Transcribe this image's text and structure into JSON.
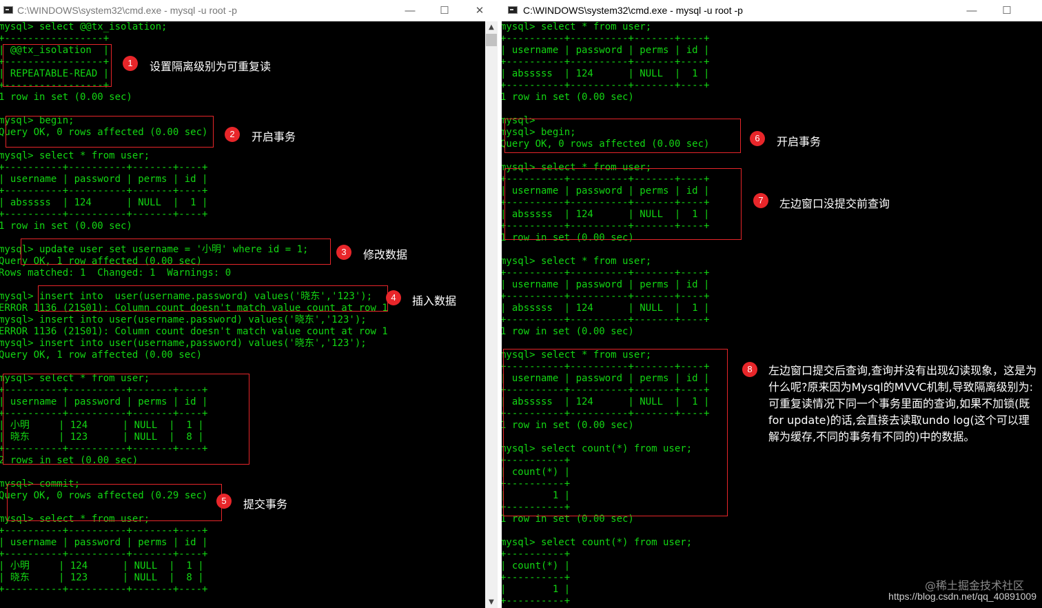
{
  "left_window": {
    "title": "C:\\WINDOWS\\system32\\cmd.exe - mysql  -u root -p",
    "lines": [
      "mysql> select @@tx_isolation;",
      "+-----------------+",
      "| @@tx_isolation  |",
      "+-----------------+",
      "| REPEATABLE-READ |",
      "+-----------------+",
      "1 row in set (0.00 sec)",
      "",
      "mysql> begin;",
      "Query OK, 0 rows affected (0.00 sec)",
      "",
      "mysql> select * from user;",
      "+----------+----------+-------+----+",
      "| username | password | perms | id |",
      "+----------+----------+-------+----+",
      "| absssss  | 124      | NULL  |  1 |",
      "+----------+----------+-------+----+",
      "1 row in set (0.00 sec)",
      "",
      "mysql> update user set username = '小明' where id = 1;",
      "Query OK, 1 row affected (0.00 sec)",
      "Rows matched: 1  Changed: 1  Warnings: 0",
      "",
      "mysql> insert into  user(username.password) values('晓东','123');",
      "ERROR 1136 (21S01): Column count doesn't match value count at row 1",
      "mysql> insert into user(username.password) values('晓东','123');",
      "ERROR 1136 (21S01): Column count doesn't match value count at row 1",
      "mysql> insert into user(username,password) values('晓东','123');",
      "Query OK, 1 row affected (0.00 sec)",
      "",
      "mysql> select * from user;",
      "+----------+----------+-------+----+",
      "| username | password | perms | id |",
      "+----------+----------+-------+----+",
      "| 小明     | 124      | NULL  |  1 |",
      "| 晓东     | 123      | NULL  |  8 |",
      "+----------+----------+-------+----+",
      "2 rows in set (0.00 sec)",
      "",
      "mysql> commit;",
      "Query OK, 0 rows affected (0.29 sec)",
      "",
      "mysql> select * from user;",
      "+----------+----------+-------+----+",
      "| username | password | perms | id |",
      "+----------+----------+-------+----+",
      "| 小明     | 124      | NULL  |  1 |",
      "| 晓东     | 123      | NULL  |  8 |",
      "+----------+----------+-------+----+"
    ]
  },
  "right_window": {
    "title": "C:\\WINDOWS\\system32\\cmd.exe - mysql  -u root -p",
    "lines": [
      "mysql> select * from user;",
      "+----------+----------+-------+----+",
      "| username | password | perms | id |",
      "+----------+----------+-------+----+",
      "| absssss  | 124      | NULL  |  1 |",
      "+----------+----------+-------+----+",
      "1 row in set (0.00 sec)",
      "",
      "mysql>",
      "mysql> begin;",
      "Query OK, 0 rows affected (0.00 sec)",
      "",
      "mysql> select * from user;",
      "+----------+----------+-------+----+",
      "| username | password | perms | id |",
      "+----------+----------+-------+----+",
      "| absssss  | 124      | NULL  |  1 |",
      "+----------+----------+-------+----+",
      "1 row in set (0.00 sec)",
      "",
      "mysql> select * from user;",
      "+----------+----------+-------+----+",
      "| username | password | perms | id |",
      "+----------+----------+-------+----+",
      "| absssss  | 124      | NULL  |  1 |",
      "+----------+----------+-------+----+",
      "1 row in set (0.00 sec)",
      "",
      "mysql> select * from user;",
      "+----------+----------+-------+----+",
      "| username | password | perms | id |",
      "+----------+----------+-------+----+",
      "| absssss  | 124      | NULL  |  1 |",
      "+----------+----------+-------+----+",
      "1 row in set (0.00 sec)",
      "",
      "mysql> select count(*) from user;",
      "+----------+",
      "| count(*) |",
      "+----------+",
      "|        1 |",
      "+----------+",
      "1 row in set (0.00 sec)",
      "",
      "mysql> select count(*) from user;",
      "+----------+",
      "| count(*) |",
      "+----------+",
      "|        1 |",
      "+----------+"
    ]
  },
  "annotations": [
    {
      "num": "1",
      "text": "设置隔离级别为可重复读"
    },
    {
      "num": "2",
      "text": "开启事务"
    },
    {
      "num": "3",
      "text": "修改数据"
    },
    {
      "num": "4",
      "text": "插入数据"
    },
    {
      "num": "5",
      "text": "提交事务"
    },
    {
      "num": "6",
      "text": "开启事务"
    },
    {
      "num": "7",
      "text": "左边窗口没提交前查询"
    },
    {
      "num": "8",
      "text": "左边窗口提交后查询,查询并没有出现幻读现象，这是为什么呢?原来因为Mysql的MVVC机制,导致隔离级别为: 可重复读情况下同一个事务里面的查询,如果不加锁(既for  update)的话,会直接去读取undo log(这个可以理解为缓存,不同的事务有不同的)中的数据。"
    }
  ],
  "watermark": {
    "site": "@稀土掘金技术社区",
    "url": "https://blog.csdn.net/qq_40891009"
  },
  "colors": {
    "terminal_bg": "#000000",
    "terminal_text": "#13d613",
    "annotation_red": "#e8262a",
    "annotation_text": "#ffffff"
  },
  "icons": {
    "window_icon": "cmd-icon",
    "minimize": "minimize-icon",
    "maximize": "maximize-icon",
    "close": "close-icon"
  }
}
